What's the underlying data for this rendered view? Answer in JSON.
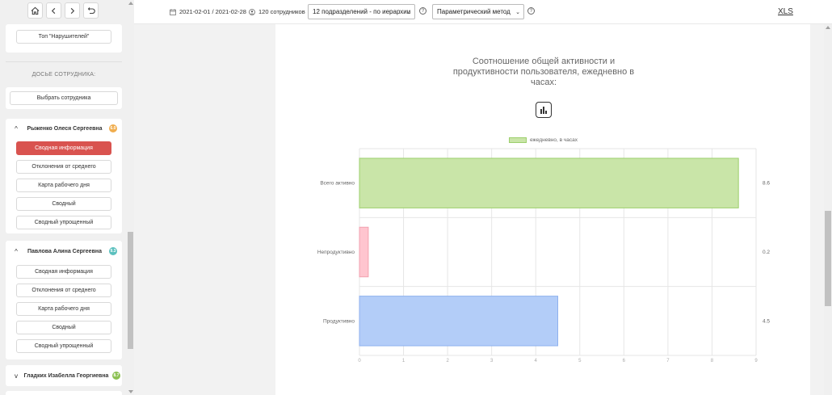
{
  "nav": {
    "home_icon": "home-icon",
    "back_icon": "chevron-left-icon",
    "forward_icon": "chevron-right-icon",
    "undo_icon": "undo-icon"
  },
  "sidebar": {
    "top_violators_label": "Топ \"Нарушителей\"",
    "dossier_label": "ДОСЬЕ СОТРУДНИКА:",
    "select_employee_label": "Выбрать сотрудника",
    "employees": [
      {
        "name": "Рыженко Олеся Сергеевна",
        "badge": "6.0",
        "badge_color": "#f0ad4e",
        "expanded": true,
        "items": [
          "Сводная информация",
          "Отклонения от среднего",
          "Карта рабочего дня",
          "Сводный",
          "Сводный упрощенный"
        ],
        "active_index": 0
      },
      {
        "name": "Павлова Алина Сергеевна",
        "badge": "9.3",
        "badge_color": "#5bc0be",
        "expanded": true,
        "items": [
          "Сводная информация",
          "Отклонения от среднего",
          "Карта рабочего дня",
          "Сводный",
          "Сводный упрощенный"
        ],
        "active_index": -1
      },
      {
        "name": "Гладких Изабелла Георгиевна",
        "badge": "8.7",
        "badge_color": "#8cc152",
        "expanded": false,
        "items": [],
        "active_index": -1
      }
    ]
  },
  "topbar": {
    "date_range": "2021-02-01 / 2021-02-28",
    "employee_count": "120 сотрудников",
    "department_select": "12 подразделений - по иерархии",
    "method_select": "Параметрический метод",
    "xls_label": "XLS"
  },
  "chart_data": {
    "type": "bar",
    "orientation": "horizontal",
    "title": "Соотношение общей активности и продуктивности пользователя, ежедневно в часах:",
    "categories": [
      "Всего активно",
      "Непродуктивно",
      "Продуктивно"
    ],
    "series": [
      {
        "name": "ежедневно, в часах",
        "values": [
          8.6,
          0.2,
          4.5
        ],
        "colors": [
          "#c9e5a8",
          "#ffc5cf",
          "#b3cdf8"
        ],
        "border_colors": [
          "#9ccf6c",
          "#f2a2b0",
          "#8fb1ee"
        ]
      }
    ],
    "data_labels": [
      "8.6",
      "0.2",
      "4.5"
    ],
    "xlim": [
      0,
      9
    ],
    "xticks": [
      "0",
      "1",
      "2",
      "3",
      "4",
      "5",
      "6",
      "7",
      "8",
      "9"
    ],
    "grid": true,
    "legend": "top-center"
  }
}
